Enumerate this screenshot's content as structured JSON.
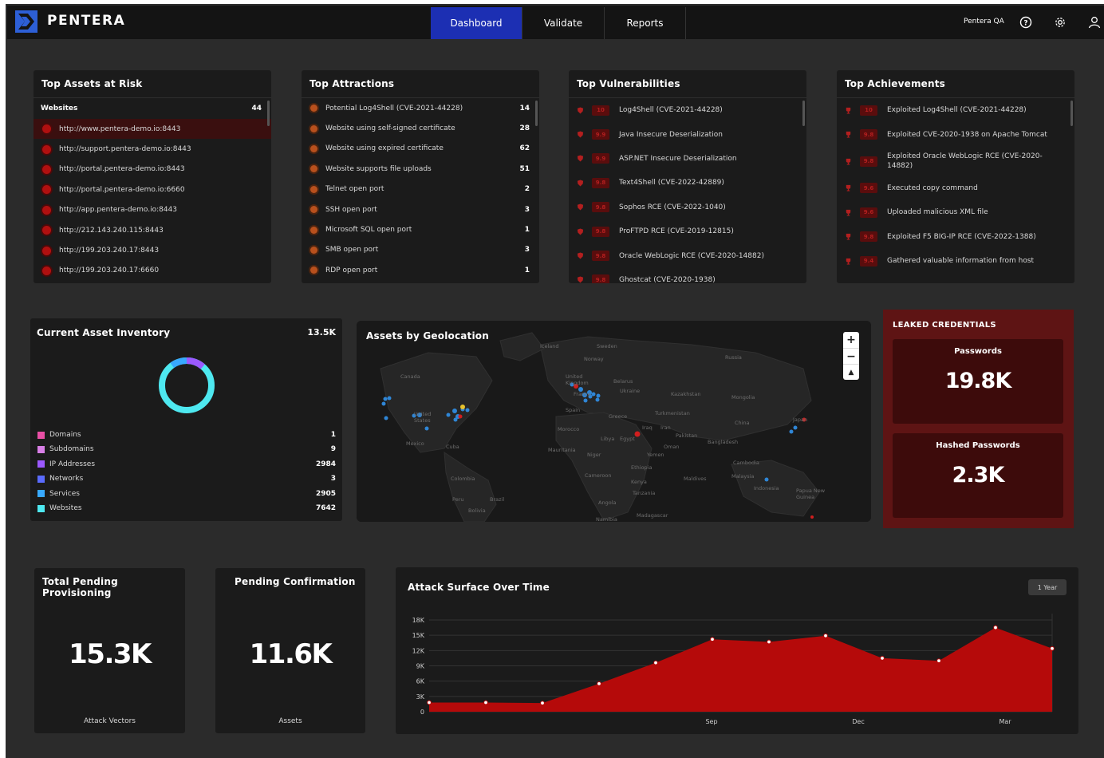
{
  "header": {
    "brand": "PENTERA",
    "tabs": [
      {
        "label": "Dashboard",
        "active": true
      },
      {
        "label": "Validate",
        "active": false
      },
      {
        "label": "Reports",
        "active": false
      }
    ],
    "user": "Pentera QA",
    "icons": [
      "help-icon",
      "settings-icon",
      "user-icon"
    ]
  },
  "top_assets": {
    "title": "Top Assets at Risk",
    "group_label": "Websites",
    "group_count": "44",
    "items": [
      "http://www.pentera-demo.io:8443",
      "http://support.pentera-demo.io:8443",
      "http://portal.pentera-demo.io:8443",
      "http://portal.pentera-demo.io:6660",
      "http://app.pentera-demo.io:8443",
      "http://212.143.240.115:8443",
      "http://199.203.240.17:8443",
      "http://199.203.240.17:6660"
    ]
  },
  "top_attractions": {
    "title": "Top Attractions",
    "items": [
      {
        "label": "Potential Log4Shell (CVE-2021-44228)",
        "count": "14"
      },
      {
        "label": "Website using self-signed certificate",
        "count": "28"
      },
      {
        "label": "Website using expired certificate",
        "count": "62"
      },
      {
        "label": "Website supports file uploads",
        "count": "51"
      },
      {
        "label": "Telnet open port",
        "count": "2"
      },
      {
        "label": "SSH open port",
        "count": "3"
      },
      {
        "label": "Microsoft SQL open port",
        "count": "1"
      },
      {
        "label": "SMB open port",
        "count": "3"
      },
      {
        "label": "RDP open port",
        "count": "1"
      }
    ]
  },
  "top_vulnerabilities": {
    "title": "Top Vulnerabilities",
    "items": [
      {
        "score": "10",
        "label": "Log4Shell (CVE-2021-44228)"
      },
      {
        "score": "9.9",
        "label": "Java Insecure Deserialization"
      },
      {
        "score": "9.9",
        "label": "ASP.NET Insecure Deserialization"
      },
      {
        "score": "9.8",
        "label": "Text4Shell (CVE-2022-42889)"
      },
      {
        "score": "9.8",
        "label": "Sophos RCE (CVE-2022-1040)"
      },
      {
        "score": "9.8",
        "label": "ProFTPD RCE (CVE-2019-12815)"
      },
      {
        "score": "9.8",
        "label": "Oracle WebLogic RCE (CVE-2020-14882)"
      },
      {
        "score": "9.8",
        "label": "Ghostcat (CVE-2020-1938)"
      }
    ]
  },
  "top_achievements": {
    "title": "Top Achievements",
    "items": [
      {
        "score": "10",
        "label": "Exploited Log4Shell (CVE-2021-44228)"
      },
      {
        "score": "9.8",
        "label": "Exploited CVE-2020-1938 on Apache Tomcat"
      },
      {
        "score": "9.8",
        "label": "Exploited Oracle WebLogic RCE (CVE-2020-14882)"
      },
      {
        "score": "9.6",
        "label": "Executed copy command"
      },
      {
        "score": "9.6",
        "label": "Uploaded malicious XML file"
      },
      {
        "score": "9.8",
        "label": "Exploited F5 BIG-IP RCE (CVE-2022-1388)"
      },
      {
        "score": "9.4",
        "label": "Gathered valuable information from host"
      }
    ]
  },
  "inventory": {
    "title": "Current Asset Inventory",
    "total": "13.5K",
    "items": [
      {
        "label": "Domains",
        "value": "1",
        "color": "#e84fa5"
      },
      {
        "label": "Subdomains",
        "value": "9",
        "color": "#d87fe6"
      },
      {
        "label": "IP Addresses",
        "value": "2984",
        "color": "#9b59ff"
      },
      {
        "label": "Networks",
        "value": "3",
        "color": "#5a6bff"
      },
      {
        "label": "Services",
        "value": "2905",
        "color": "#38a9ff"
      },
      {
        "label": "Websites",
        "value": "7642",
        "color": "#4ee8f0"
      }
    ]
  },
  "geo": {
    "title": "Assets by Geolocation",
    "labels": [
      "Iceland",
      "Sweden",
      "Norway",
      "Russia",
      "Canada",
      "United Kingdom",
      "Belarus",
      "Ukraine",
      "Kazakhstan",
      "Mongolia",
      "France",
      "Spain",
      "Greece",
      "Turkmenistan",
      "China",
      "United States",
      "Iraq",
      "Iran",
      "Japan",
      "Morocco",
      "Libya",
      "Egypt",
      "Pakistan",
      "Mexico",
      "Cuba",
      "Mauritania",
      "Niger",
      "Oman",
      "Bangladesh",
      "Yemen",
      "Cambodia",
      "Ethiopia",
      "Maldives",
      "Malaysia",
      "Cameroon",
      "Colombia",
      "Kenya",
      "Indonesia",
      "Papua New Guinea",
      "Tanzania",
      "Peru",
      "Brazil",
      "Angola",
      "Bolivia",
      "Namibia",
      "Madagascar"
    ]
  },
  "leaked": {
    "title": "LEAKED CREDENTIALS",
    "passwords_label": "Passwords",
    "passwords_value": "19.8K",
    "hashed_label": "Hashed Passwords",
    "hashed_value": "2.3K"
  },
  "pending_provisioning": {
    "title": "Total Pending Provisioning",
    "value": "15.3K",
    "sublabel": "Attack Vectors"
  },
  "pending_confirmation": {
    "title": "Pending Confirmation",
    "value": "11.6K",
    "sublabel": "Assets"
  },
  "attack_surface": {
    "title": "Attack Surface Over Time",
    "range_button": "1 Year"
  },
  "chart_data": {
    "type": "area",
    "title": "Attack Surface Over Time",
    "x_tick_labels": [
      "Sep",
      "Dec",
      "Mar"
    ],
    "y_tick_labels": [
      "0",
      "3K",
      "6K",
      "9K",
      "12K",
      "15K",
      "18K"
    ],
    "ylim": [
      0,
      18000
    ],
    "color": "#b50a0a",
    "series": [
      {
        "values": [
          1800,
          1800,
          1700,
          5500,
          9600,
          14200,
          13700,
          14900,
          10500,
          10000,
          16500,
          12400
        ]
      }
    ]
  }
}
